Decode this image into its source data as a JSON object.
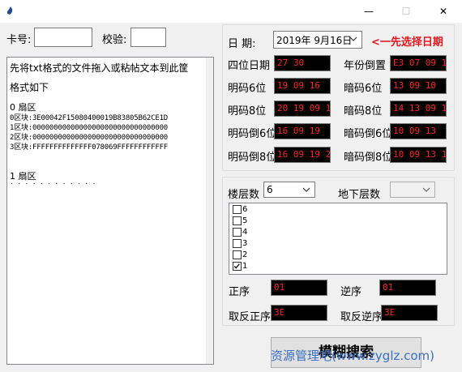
{
  "window": {
    "minimize_glyph": "—",
    "maximize_glyph": "☐",
    "close_glyph": "✕"
  },
  "top_fields": {
    "card_label": "卡号:",
    "card_value": "",
    "check_label": "校验:",
    "check_value": ""
  },
  "textarea": {
    "line1": "先将txt格式的文件拖入或粘帖文本到此筐",
    "line2": "格式如下",
    "sector0_title": "0 扇区",
    "block0": "0区块:3E00042F15080400019B83805B62CE1D",
    "block1": "1区块:00000000000000000000000000000000",
    "block2": "2区块:00000000000000000000000000000000",
    "block3": "3区块:FFFFFFFFFFFFFF078069FFFFFFFFFFFF",
    "sector1_title": "1 扇区",
    "dots": "· · · · · · · · · · · ·"
  },
  "date_group": {
    "date_label": "日  期:",
    "date_value": "2019年  9月16日",
    "hint": "<一先选择日期",
    "rows": [
      {
        "left_label": "四位日期",
        "left_value": "27 30",
        "right_label": "年份倒置",
        "right_value": "E3 07 09 10"
      },
      {
        "left_label": "明码6位",
        "left_value": "19 09 16",
        "right_label": "暗码6位",
        "right_value": "13 09 10"
      },
      {
        "left_label": "明码8位",
        "left_value": "20 19 09 16",
        "right_label": "暗码8位",
        "right_value": "14 13 09 10"
      },
      {
        "left_label": "明码倒6位",
        "left_value": "16 09 19",
        "right_label": "暗码倒6位",
        "right_value": "10 09 13"
      },
      {
        "left_label": "明码倒8位",
        "left_value": "16 09 19 20",
        "right_label": "暗码倒8位",
        "right_value": "10 09 13 14"
      }
    ]
  },
  "floor_group": {
    "floors_label": "楼层数",
    "floors_value": "6",
    "underground_label": "地下层数",
    "underground_value": "",
    "floors": [
      {
        "label": "6",
        "checked": false
      },
      {
        "label": "5",
        "checked": false
      },
      {
        "label": "4",
        "checked": false
      },
      {
        "label": "3",
        "checked": false
      },
      {
        "label": "2",
        "checked": false
      },
      {
        "label": "1",
        "checked": true
      }
    ],
    "forward_label": "正序",
    "forward_value": "01",
    "reverse_label": "逆序",
    "reverse_value": "01",
    "inv_forward_label": "取反正序",
    "inv_forward_value": "3E",
    "inv_reverse_label": "取反逆序",
    "inv_reverse_value": "3E"
  },
  "fuzzy_search_label": "模糊搜索",
  "watermark": "资源管理吧(www.zyglz.com)",
  "colors": {
    "led_background": "#000000",
    "led_text": "#ff2222",
    "hint_text": "#e4161e",
    "watermark_text": "#3a6fc4"
  },
  "icons": {
    "app": "app-icon",
    "dropdown": "chevron-down-icon",
    "check": "check-icon"
  }
}
